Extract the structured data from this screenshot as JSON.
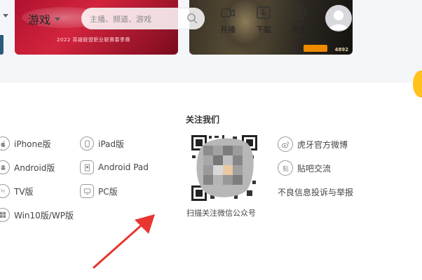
{
  "header": {
    "category": "游戏",
    "search_placeholder": "主播、频道、游戏",
    "buttons": [
      {
        "label": "开播",
        "icon": "camera-icon"
      },
      {
        "label": "下载",
        "icon": "download-icon"
      },
      {
        "label": "历史",
        "icon": "clock-icon"
      }
    ]
  },
  "banners": {
    "left_title": "2022 英雄联盟职业联赛春季赛",
    "right_number": "4892"
  },
  "follow": {
    "title": "关注我们",
    "qr_caption": "扫描关注微信公众号"
  },
  "platforms": [
    {
      "label": "iPhone版",
      "icon": "apple-icon"
    },
    {
      "label": "iPad版",
      "icon": "ipad-icon"
    },
    {
      "label": "Android版",
      "icon": "android-icon"
    },
    {
      "label": "Android Pad",
      "icon": "android-pad-icon"
    },
    {
      "label": "TV版",
      "icon": "tv-icon"
    },
    {
      "label": "PC版",
      "icon": "pc-icon"
    },
    {
      "label": "Win10版/WP版",
      "icon": "windows-icon"
    }
  ],
  "social": [
    {
      "label": "虎牙官方微博",
      "icon": "weibo-icon"
    },
    {
      "label": "贴吧交流",
      "icon": "tieba-icon"
    }
  ],
  "report_link": "不良信息投诉与举报",
  "colors": {
    "page_bg": "#ffffff",
    "top_bg": "#f4f5f8",
    "arrow": "#e8352f",
    "brand_orange": "#f08a00"
  }
}
